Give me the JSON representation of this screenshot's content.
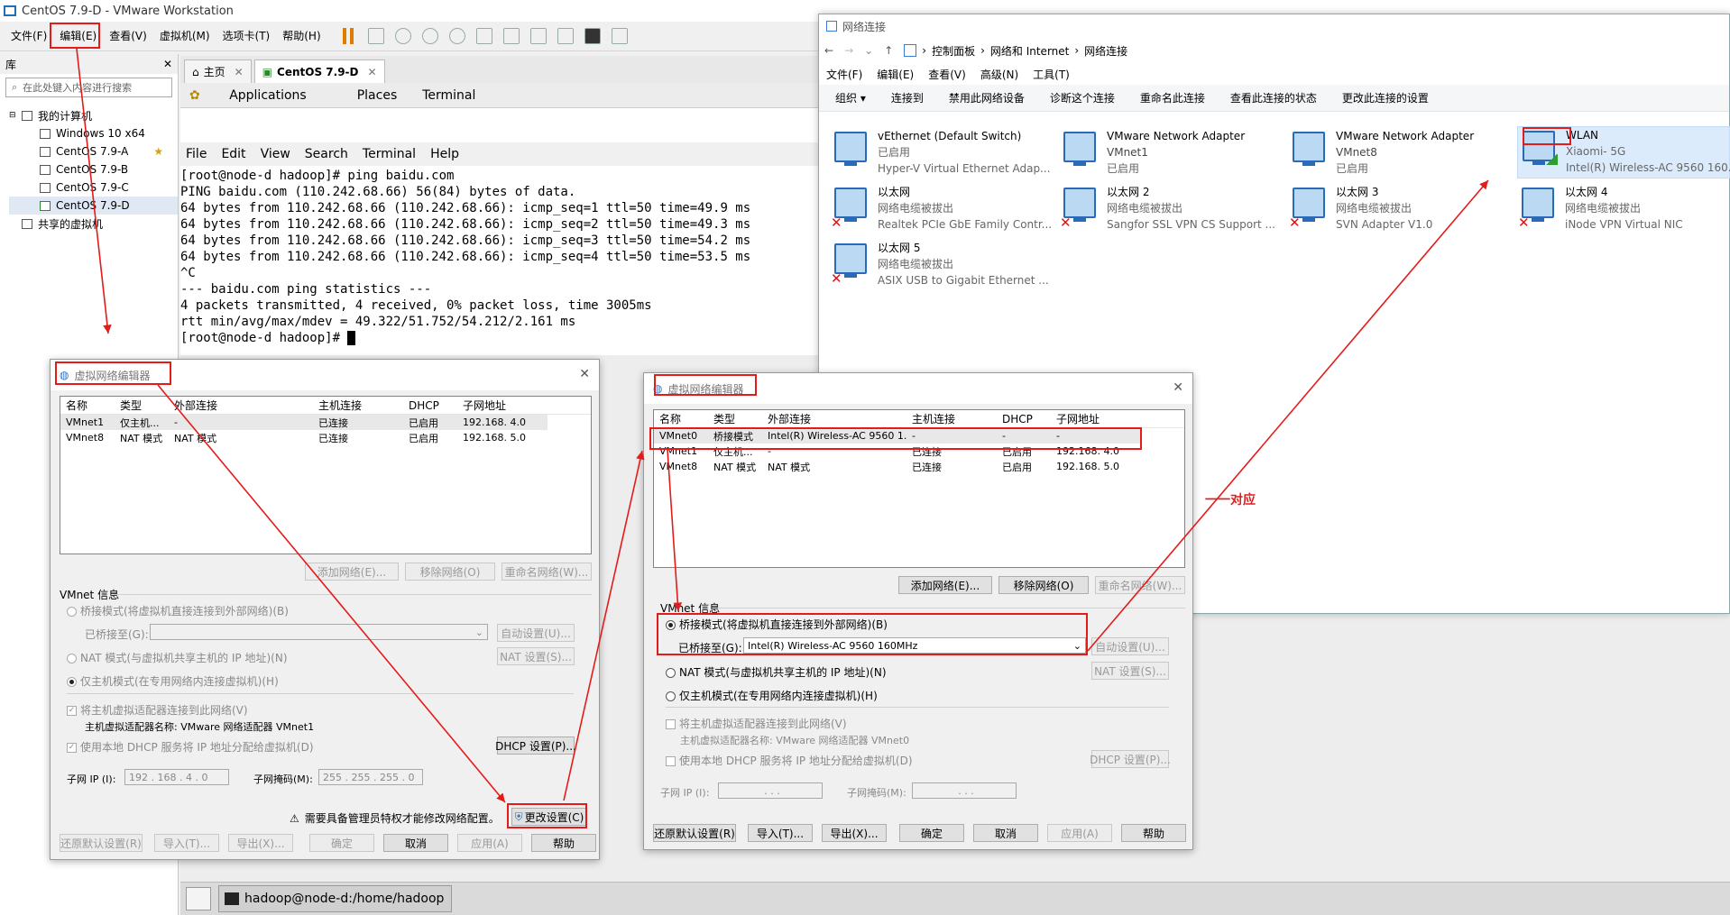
{
  "vmware": {
    "title": "CentOS 7.9-D - VMware Workstation",
    "menu": [
      "文件(F)",
      "编辑(E)",
      "查看(V)",
      "虚拟机(M)",
      "选项卡(T)",
      "帮助(H)"
    ],
    "library": {
      "title": "库",
      "search_placeholder": "在此处键入内容进行搜索",
      "tree": [
        "我的计算机",
        "Windows 10 x64",
        "CentOS 7.9-A",
        "CentOS 7.9-B",
        "CentOS 7.9-C",
        "CentOS 7.9-D",
        "共享的虚拟机"
      ]
    },
    "tabs": [
      "主页",
      "CentOS 7.9-D"
    ],
    "gnome_bar": [
      "Applications",
      "Places",
      "Terminal"
    ],
    "terminal_menu": [
      "File",
      "Edit",
      "View",
      "Search",
      "Terminal",
      "Help"
    ],
    "terminal_lines": [
      "[root@node-d hadoop]# ping baidu.com",
      "PING baidu.com (110.242.68.66) 56(84) bytes of data.",
      "64 bytes from 110.242.68.66 (110.242.68.66): icmp_seq=1 ttl=50 time=49.9 ms",
      "64 bytes from 110.242.68.66 (110.242.68.66): icmp_seq=2 ttl=50 time=49.3 ms",
      "64 bytes from 110.242.68.66 (110.242.68.66): icmp_seq=3 ttl=50 time=54.2 ms",
      "64 bytes from 110.242.68.66 (110.242.68.66): icmp_seq=4 ttl=50 time=53.5 ms",
      "^C",
      "--- baidu.com ping statistics ---",
      "4 packets transmitted, 4 received, 0% packet loss, time 3005ms",
      "rtt min/avg/max/mdev = 49.322/51.752/54.212/2.161 ms"
    ],
    "terminal_prompt": "[root@node-d hadoop]# ",
    "taskbar_item": "hadoop@node-d:/home/hadoop"
  },
  "explorer": {
    "title": "网络连接",
    "breadcrumb": [
      "控制面板",
      "网络和 Internet",
      "网络连接"
    ],
    "menu": [
      "文件(F)",
      "编辑(E)",
      "查看(V)",
      "高级(N)",
      "工具(T)"
    ],
    "commands": [
      "组织 ▾",
      "连接到",
      "禁用此网络设备",
      "诊断这个连接",
      "重命名此连接",
      "查看此连接的状态",
      "更改此连接的设置"
    ],
    "adapters": [
      {
        "name": "vEthernet (Default Switch)",
        "status": "已启用",
        "device": "Hyper-V Virtual Ethernet Adap...",
        "state": "ok"
      },
      {
        "name": "VMware Network Adapter",
        "status": "VMnet1",
        "device": "已启用",
        "state": "ok"
      },
      {
        "name": "VMware Network Adapter",
        "status": "VMnet8",
        "device": "已启用",
        "state": "ok"
      },
      {
        "name": "WLAN",
        "status": "Xiaomi-        5G",
        "device": "Intel(R) Wireless-AC 9560 160...",
        "state": "wifi"
      },
      {
        "name": "以太网",
        "status": "网络电缆被拔出",
        "device": "Realtek PCIe GbE Family Contr...",
        "state": "off"
      },
      {
        "name": "以太网 2",
        "status": "网络电缆被拔出",
        "device": "Sangfor SSL VPN CS Support ...",
        "state": "off"
      },
      {
        "name": "以太网 3",
        "status": "网络电缆被拔出",
        "device": "SVN Adapter V1.0",
        "state": "off"
      },
      {
        "name": "以太网 4",
        "status": "网络电缆被拔出",
        "device": "iNode VPN Virtual NIC",
        "state": "off"
      },
      {
        "name": "以太网 5",
        "status": "网络电缆被拔出",
        "device": "ASIX USB to Gigabit Ethernet ...",
        "state": "off"
      }
    ]
  },
  "dialog1": {
    "title": "虚拟网络编辑器",
    "columns": [
      "名称",
      "类型",
      "外部连接",
      "主机连接",
      "DHCP",
      "子网地址"
    ],
    "rows": [
      [
        "VMnet1",
        "仅主机...",
        "-",
        "已连接",
        "已启用",
        "192.168.  4.0"
      ],
      [
        "VMnet8",
        "NAT 模式",
        "NAT 模式",
        "已连接",
        "已启用",
        "192.168.  5.0"
      ]
    ],
    "buttons_row": [
      "添加网络(E)...",
      "移除网络(O)",
      "重命名网络(W)..."
    ],
    "info_title": "VMnet 信息",
    "bridge_label": "桥接模式(将虚拟机直接连接到外部网络)(B)",
    "bridged_to_label": "已桥接至(G):",
    "bridged_to_value": "",
    "auto_btn": "自动设置(U)...",
    "nat_label": "NAT 模式(与虚拟机共享主机的 IP 地址)(N)",
    "nat_btn": "NAT 设置(S)...",
    "hostonly_label": "仅主机模式(在专用网络内连接虚拟机)(H)",
    "connect_adapter": "将主机虚拟适配器连接到此网络(V)",
    "adapter_name": "主机虚拟适配器名称: VMware 网络适配器 VMnet1",
    "dhcp_label": "使用本地 DHCP 服务将 IP 地址分配给虚拟机(D)",
    "dhcp_btn": "DHCP 设置(P)...",
    "subnet_ip_label": "子网 IP (I):",
    "subnet_ip": "192 . 168 .   4 . 0",
    "mask_label": "子网掩码(M):",
    "mask": "255 . 255 . 255 . 0",
    "warning": "需要具备管理员特权才能修改网络配置。",
    "change_btn": "更改设置(C)",
    "bottom_buttons": [
      "还原默认设置(R)",
      "导入(T)...",
      "导出(X)...",
      "确定",
      "取消",
      "应用(A)",
      "帮助"
    ]
  },
  "dialog2": {
    "title": "虚拟网络编辑器",
    "columns": [
      "名称",
      "类型",
      "外部连接",
      "主机连接",
      "DHCP",
      "子网地址"
    ],
    "rows": [
      [
        "VMnet0",
        "桥接模式",
        "Intel(R) Wireless-AC 9560 1...",
        "-",
        "-",
        "-"
      ],
      [
        "VMnet1",
        "仅主机...",
        "-",
        "已连接",
        "已启用",
        "192.168.  4.0"
      ],
      [
        "VMnet8",
        "NAT 模式",
        "NAT 模式",
        "已连接",
        "已启用",
        "192.168.  5.0"
      ]
    ],
    "buttons_row": [
      "添加网络(E)...",
      "移除网络(O)",
      "重命名网络(W)..."
    ],
    "info_title": "VMnet 信息",
    "bridge_label": "桥接模式(将虚拟机直接连接到外部网络)(B)",
    "bridged_to_label": "已桥接至(G):",
    "bridged_to_value": "Intel(R) Wireless-AC 9560 160MHz",
    "auto_btn": "自动设置(U)...",
    "nat_label": "NAT 模式(与虚拟机共享主机的 IP 地址)(N)",
    "nat_btn": "NAT 设置(S)...",
    "hostonly_label": "仅主机模式(在专用网络内连接虚拟机)(H)",
    "connect_adapter": "将主机虚拟适配器连接到此网络(V)",
    "adapter_name": "主机虚拟适配器名称: VMware 网络适配器 VMnet0",
    "dhcp_label": "使用本地 DHCP 服务将 IP 地址分配给虚拟机(D)",
    "dhcp_btn": "DHCP 设置(P)...",
    "subnet_ip_label": "子网 IP (I):",
    "subnet_ip": ".   .   .",
    "mask_label": "子网掩码(M):",
    "mask": ".   .   .",
    "bottom_buttons": [
      "还原默认设置(R)",
      "导入(T)...",
      "导出(X)...",
      "确定",
      "取消",
      "应用(A)",
      "帮助"
    ]
  },
  "annotation": {
    "label": "一一对应",
    "color": "#e41b1b"
  }
}
